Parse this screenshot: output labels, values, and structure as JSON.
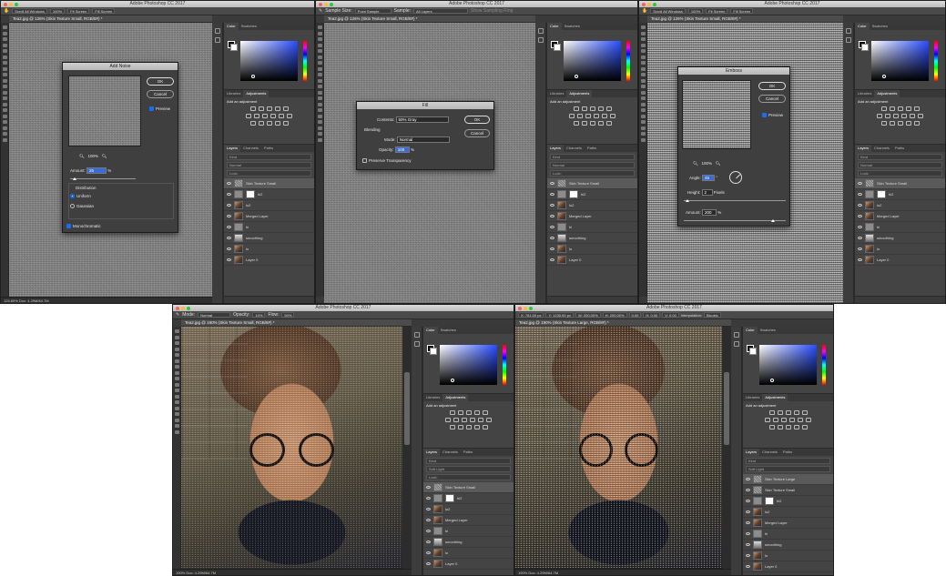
{
  "windows": {
    "w1": {
      "title": "Adobe Photoshop CC 2017",
      "options": [
        "Scroll All Windows",
        "100%",
        "Fit Screen",
        "Fill Screen"
      ],
      "tab": "Tea2.jpg @ 126% (Skin Texture Small, RGB/8#) *",
      "status": "125.89%       Doc: 4.29M/64.7M"
    },
    "w2": {
      "title": "Adobe Photoshop CC 2017",
      "options": [
        "Sample Size:",
        "Point Sample",
        "Sample:",
        "All Layers",
        "Show Sampling Ring"
      ],
      "tab": "Tea2.jpg @ 126% (Skin Texture Small, RGB/8#) *"
    },
    "w3": {
      "title": "Adobe Photoshop CC 2017",
      "options": [
        "Scroll All Windows",
        "100%",
        "Fit Screen",
        "Fill Screen"
      ],
      "tab": "Tea2.jpg @ 126% (Skin Texture Small, RGB/8#) *"
    },
    "w4": {
      "title": "Adobe Photoshop CC 2017",
      "options": [
        "Mode:",
        "Normal",
        "Opacity:",
        "10%",
        "Flow:",
        "50%"
      ],
      "tab": "Tea2.jpg @ 190% (Skin Texture Small, RGB/8#) *",
      "status": "190%       Doc: 4.29M/64.7M"
    },
    "w5": {
      "title": "Adobe Photoshop CC 2017",
      "options": [
        "X: 761.00 px",
        "Y: 1230.00 px",
        "W: 200.00%",
        "H: 200.00%",
        "0.00",
        "H: 0.00",
        "V: 0.00",
        "Interpolation:",
        "Bicubic"
      ],
      "tab": "Tea2.jpg @ 190% (Skin Texture Large, RGB/8#) *",
      "status": "190%       Doc: 4.29M/64.7M"
    }
  },
  "panels": {
    "tabs_color": [
      "Color",
      "Swatches"
    ],
    "tabs_adj": [
      "Libraries",
      "Adjustments"
    ],
    "add_adjustment": "Add an adjustment",
    "tabs_layers": [
      "Layers",
      "Channels",
      "Paths"
    ],
    "kind": "Kind",
    "blend_normal": "Normal",
    "blend_softlight": "Soft Light",
    "opacity": "Opacity: 100%",
    "lock": "Lock:",
    "fill": "Fill: 100%",
    "layers": [
      {
        "name": "Skin Texture Small",
        "thumb": "noise",
        "selected": true
      },
      {
        "name": "hi2",
        "thumb": "mask"
      },
      {
        "name": "lo2",
        "thumb": "face"
      },
      {
        "name": "Merged Layer",
        "thumb": "face"
      },
      {
        "name": "hi",
        "thumb": "gray"
      },
      {
        "name": "smoothing",
        "thumb": "grad"
      },
      {
        "name": "lo",
        "thumb": "face"
      },
      {
        "name": "Layer 0",
        "thumb": "face"
      }
    ],
    "layers5_top": "Skin Texture Large"
  },
  "add_noise": {
    "title": "Add Noise",
    "ok": "OK",
    "cancel": "Cancel",
    "preview": "Preview",
    "zoom": "100%",
    "amount_label": "Amount:",
    "amount_value": "25",
    "amount_unit": "%",
    "distribution": "Distribution",
    "uniform": "Uniform",
    "gaussian": "Gaussian",
    "monochromatic": "Monochromatic"
  },
  "fill": {
    "title": "Fill",
    "contents_label": "Contents:",
    "contents_value": "50% Gray",
    "ok": "OK",
    "cancel": "Cancel",
    "blending": "Blending",
    "mode_label": "Mode:",
    "mode_value": "Normal",
    "opacity_label": "Opacity:",
    "opacity_value": "100",
    "opacity_unit": "%",
    "preserve": "Preserve Transparency"
  },
  "emboss": {
    "title": "Emboss",
    "ok": "OK",
    "cancel": "Cancel",
    "preview": "Preview",
    "zoom": "100%",
    "angle_label": "Angle:",
    "angle_value": "45",
    "angle_unit": "°",
    "height_label": "Height:",
    "height_value": "2",
    "height_unit": "Pixels",
    "amount_label": "Amount:",
    "amount_value": "200",
    "amount_unit": "%"
  }
}
